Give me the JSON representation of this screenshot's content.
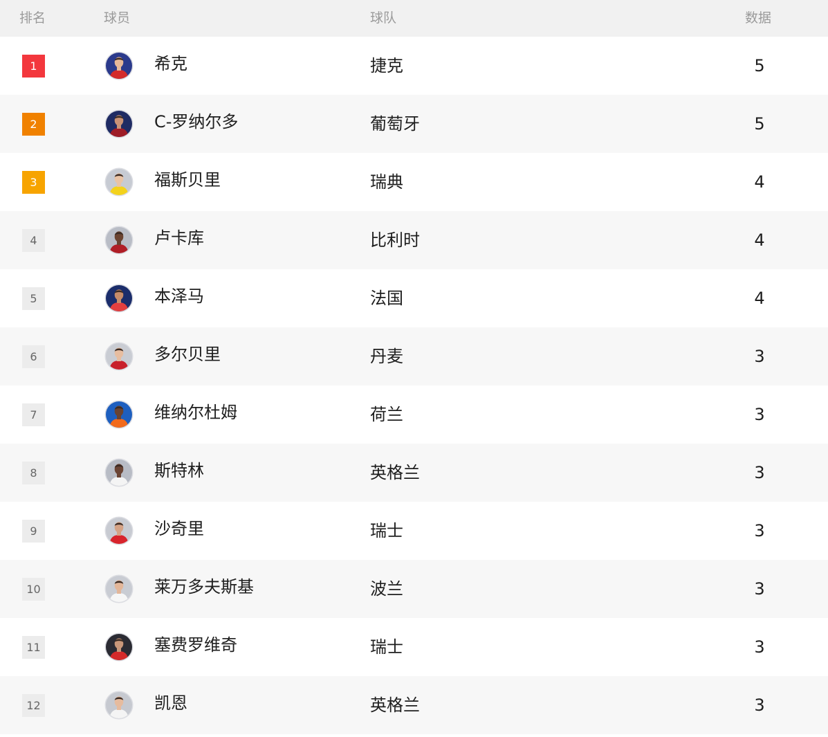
{
  "header": {
    "rank": "排名",
    "player": "球员",
    "team": "球队",
    "data": "数据"
  },
  "colors": {
    "rank1": "#f3373d",
    "rank2": "#f08100",
    "rank3": "#f7a400",
    "rank_default_bg": "#ececec",
    "row_alt_bg": "#f7f7f7",
    "header_bg": "#f1f1f1"
  },
  "rows": [
    {
      "rank": "1",
      "name": "希克",
      "team": "捷克",
      "value": "5",
      "avatar_icon": "player-avatar-icon",
      "bg": "#2b3a8c",
      "shirt": "#d32b2b",
      "skin": "#e7b899"
    },
    {
      "rank": "2",
      "name": "C-罗纳尔多",
      "team": "葡萄牙",
      "value": "5",
      "avatar_icon": "player-avatar-icon",
      "bg": "#1f2b63",
      "shirt": "#9e1d27",
      "skin": "#c99276"
    },
    {
      "rank": "3",
      "name": "福斯贝里",
      "team": "瑞典",
      "value": "4",
      "avatar_icon": "player-avatar-icon",
      "bg": "#c7cbd3",
      "shirt": "#f3d21c",
      "skin": "#e9c3a5"
    },
    {
      "rank": "4",
      "name": "卢卡库",
      "team": "比利时",
      "value": "4",
      "avatar_icon": "player-avatar-icon",
      "bg": "#b9bdc6",
      "shirt": "#b01e26",
      "skin": "#6a4330"
    },
    {
      "rank": "5",
      "name": "本泽马",
      "team": "法国",
      "value": "4",
      "avatar_icon": "player-avatar-icon",
      "bg": "#1b2d6b",
      "shirt": "#e23f3f",
      "skin": "#c68c6a"
    },
    {
      "rank": "6",
      "name": "多尔贝里",
      "team": "丹麦",
      "value": "3",
      "avatar_icon": "player-avatar-icon",
      "bg": "#c9ccd3",
      "shirt": "#c8202b",
      "skin": "#e7bda0"
    },
    {
      "rank": "7",
      "name": "维纳尔杜姆",
      "team": "荷兰",
      "value": "3",
      "avatar_icon": "player-avatar-icon",
      "bg": "#1e5fbf",
      "shirt": "#f26b1d",
      "skin": "#6a4331"
    },
    {
      "rank": "8",
      "name": "斯特林",
      "team": "英格兰",
      "value": "3",
      "avatar_icon": "player-avatar-icon",
      "bg": "#b8bcc5",
      "shirt": "#f4f4f4",
      "skin": "#6a4434"
    },
    {
      "rank": "9",
      "name": "沙奇里",
      "team": "瑞士",
      "value": "3",
      "avatar_icon": "player-avatar-icon",
      "bg": "#c8cbd2",
      "shirt": "#d8242c",
      "skin": "#d5a386"
    },
    {
      "rank": "10",
      "name": "莱万多夫斯基",
      "team": "波兰",
      "value": "3",
      "avatar_icon": "player-avatar-icon",
      "bg": "#c9ccd3",
      "shirt": "#f6f6f6",
      "skin": "#e3b699"
    },
    {
      "rank": "11",
      "name": "塞费罗维奇",
      "team": "瑞士",
      "value": "3",
      "avatar_icon": "player-avatar-icon",
      "bg": "#2b2b33",
      "shirt": "#d42a2a",
      "skin": "#c9977a"
    },
    {
      "rank": "12",
      "name": "凯恩",
      "team": "英格兰",
      "value": "3",
      "avatar_icon": "player-avatar-icon",
      "bg": "#c6c9d0",
      "shirt": "#f4f4f4",
      "skin": "#e6bb9e"
    }
  ]
}
